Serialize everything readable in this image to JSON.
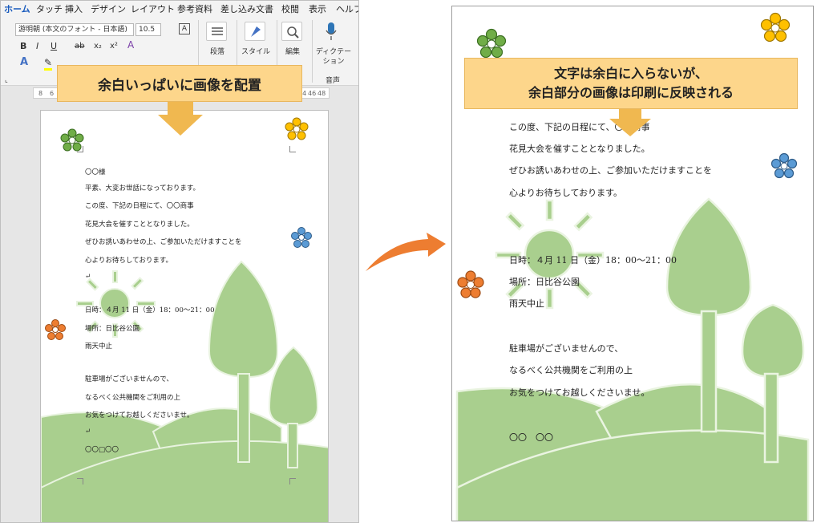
{
  "ribbon": {
    "tabs": [
      "ホーム",
      "タッチ",
      "挿入",
      "デザイン",
      "レイアウト",
      "参考資料",
      "差し込み文書",
      "校閲",
      "表示",
      "ヘルプ"
    ],
    "font_name": "游明朝 (本文のフォント - 日本語)",
    "font_size": "10.5",
    "paragraph_label": "段落",
    "style_label": "スタイル",
    "edit_label": "編集",
    "dictation_label_1": "ディクテー",
    "dictation_label_2": "ション",
    "voice_group_label": "音声",
    "bold": "B",
    "italic": "I",
    "underline": "U",
    "strike": "ab",
    "subscript": "x₂",
    "superscript": "x²"
  },
  "ruler": {
    "left": [
      "8",
      "6"
    ],
    "right": [
      "44",
      "46",
      "48"
    ]
  },
  "callouts": {
    "left": "余白いっぱいに画像を配置",
    "right_line1": "文字は余白に入らないが、",
    "right_line2": "余白部分の画像は印刷に反映される"
  },
  "letter": {
    "addressee": "〇〇様",
    "l1": "平素、大変お世話になっております。",
    "l2": "この度、下記の日程にて、〇〇商事",
    "l3": "花見大会を催すこととなりました。",
    "l4": "ぜひお誘いあわせの上、ご参加いただけますことを",
    "l5": "心よりお待ちしております。",
    "date": "日時：４月 11 日（金）18：00～21：00",
    "place": "場所：日比谷公園",
    "rain": "雨天中止",
    "parking1": "駐車場がございませんので、",
    "parking2": "なるべく公共機関をご利用の上",
    "parking3": "お気をつけてお越しくださいませ。",
    "signature_left": "〇〇□〇〇",
    "signature_right": "〇〇　〇〇",
    "para_mark": "↵"
  },
  "colors": {
    "green_art": "#a9cf8e",
    "flower_green": "#70ad47",
    "flower_yellow": "#ffc000",
    "flower_blue": "#5b9bd5",
    "flower_orange": "#ed7d31",
    "callout_fill": "#fdd68b",
    "arrow_fill": "#f0b850",
    "transition_arrow": "#ed7d31",
    "accent_blue": "#185abd"
  }
}
